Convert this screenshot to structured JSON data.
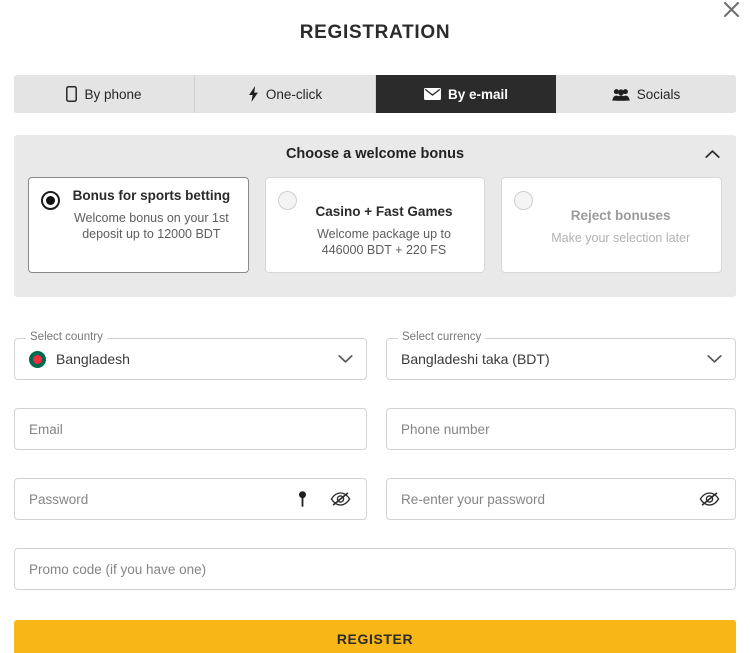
{
  "modal": {
    "title": "REGISTRATION",
    "close_icon": "close-x-icon"
  },
  "tabs": [
    {
      "label": "By phone",
      "icon": "mobile-phone-icon",
      "active": false
    },
    {
      "label": "One-click",
      "icon": "lightning-bolt-icon",
      "active": false
    },
    {
      "label": "By e-mail",
      "icon": "envelope-icon",
      "active": true
    },
    {
      "label": "Socials",
      "icon": "people-group-icon",
      "active": false
    }
  ],
  "bonus": {
    "header": "Choose a welcome bonus",
    "chevron_icon": "chevron-up-icon",
    "cards": [
      {
        "title": "Bonus for sports betting",
        "subtitle": "Welcome bonus on your 1st deposit up to 12000 BDT",
        "selected": true,
        "disabled": false
      },
      {
        "title": "Casino + Fast Games",
        "subtitle": "Welcome package up to 446000 BDT + 220 FS",
        "selected": false,
        "disabled": false
      },
      {
        "title": "Reject bonuses",
        "subtitle": "Make your selection later",
        "selected": false,
        "disabled": true
      }
    ]
  },
  "form": {
    "country": {
      "legend": "Select country",
      "value": "Bangladesh",
      "flag_icon": "bangladesh-flag-icon",
      "chevron_icon": "chevron-down-icon"
    },
    "currency": {
      "legend": "Select currency",
      "value": "Bangladeshi taka (BDT)",
      "chevron_icon": "chevron-down-icon"
    },
    "email": {
      "placeholder": "Email",
      "value": ""
    },
    "phone": {
      "placeholder": "Phone number",
      "value": ""
    },
    "password": {
      "placeholder": "Password",
      "value": "",
      "key_icon": "key-icon",
      "eye_icon": "eye-slash-icon"
    },
    "password_confirm": {
      "placeholder": "Re-enter your password",
      "value": "",
      "eye_icon": "eye-slash-icon"
    },
    "promo": {
      "placeholder": "Promo code (if you have one)",
      "value": ""
    }
  },
  "submit": {
    "label": "REGISTER"
  },
  "colors": {
    "accent": "#f9b717",
    "active_tab_bg": "#2b2b2b",
    "panel_bg": "#e9e9e9",
    "tab_bg": "#e4e4e4",
    "flag_green": "#006a4e",
    "flag_red": "#f42a41"
  }
}
